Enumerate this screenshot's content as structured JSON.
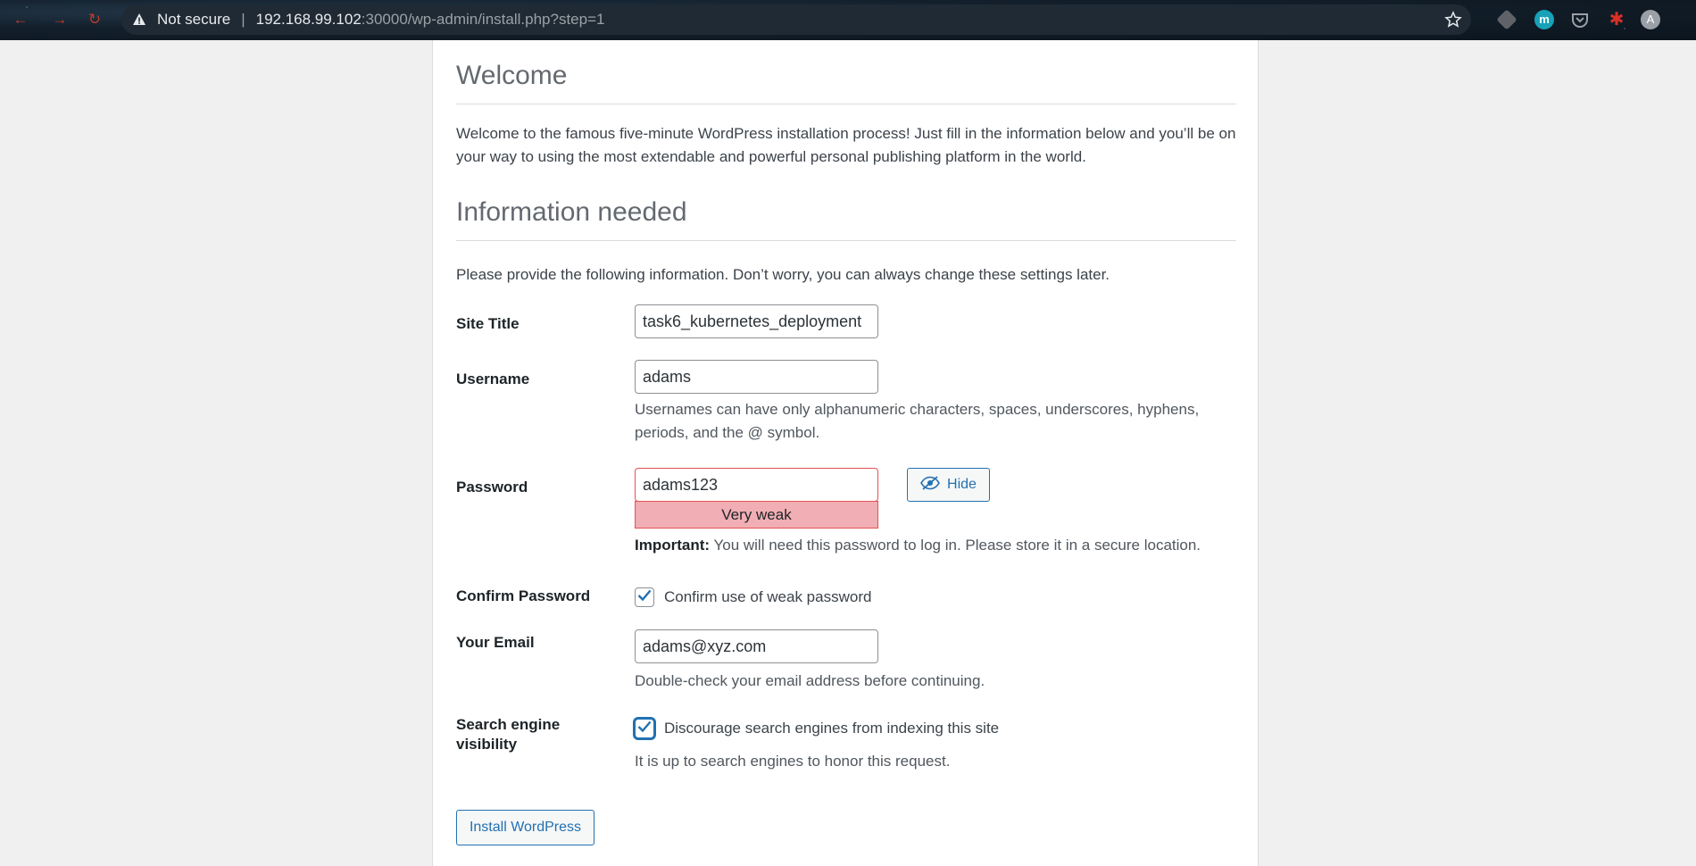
{
  "browser": {
    "security_label": "Not secure",
    "url_host": "192.168.99.102",
    "url_path": ":30000/wp-admin/install.php?step=1",
    "extension_m_label": "m",
    "profile_initial": "A"
  },
  "page": {
    "welcome_heading": "Welcome",
    "welcome_text": "Welcome to the famous five-minute WordPress installation process! Just fill in the information below and you’ll be on your way to using the most extendable and powerful personal publishing platform in the world.",
    "info_heading": "Information needed",
    "info_text": "Please provide the following information. Don’t worry, you can always change these settings later."
  },
  "form": {
    "site_title": {
      "label": "Site Title",
      "value": "task6_kubernetes_deployment"
    },
    "username": {
      "label": "Username",
      "value": "adams",
      "description": "Usernames can have only alphanumeric characters, spaces, underscores, hyphens, periods, and the @ symbol."
    },
    "password": {
      "label": "Password",
      "value": "adams123",
      "hide_label": "Hide",
      "strength": "Very weak",
      "important_prefix": "Important:",
      "important_text": " You will need this password to log in. Please store it in a secure location."
    },
    "confirm_password": {
      "label": "Confirm Password",
      "checkbox_label": "Confirm use of weak password",
      "checked": true
    },
    "email": {
      "label": "Your Email",
      "value": "adams@xyz.com",
      "description": "Double-check your email address before continuing."
    },
    "search_visibility": {
      "label_line1": "Search engine",
      "label_line2": "visibility",
      "checkbox_label": "Discourage search engines from indexing this site",
      "checked": true,
      "description": "It is up to search engines to honor this request."
    },
    "submit_label": "Install WordPress"
  },
  "colors": {
    "accent": "#2271b1",
    "weak_bg": "#f1aeb5",
    "weak_border": "#e65054"
  }
}
